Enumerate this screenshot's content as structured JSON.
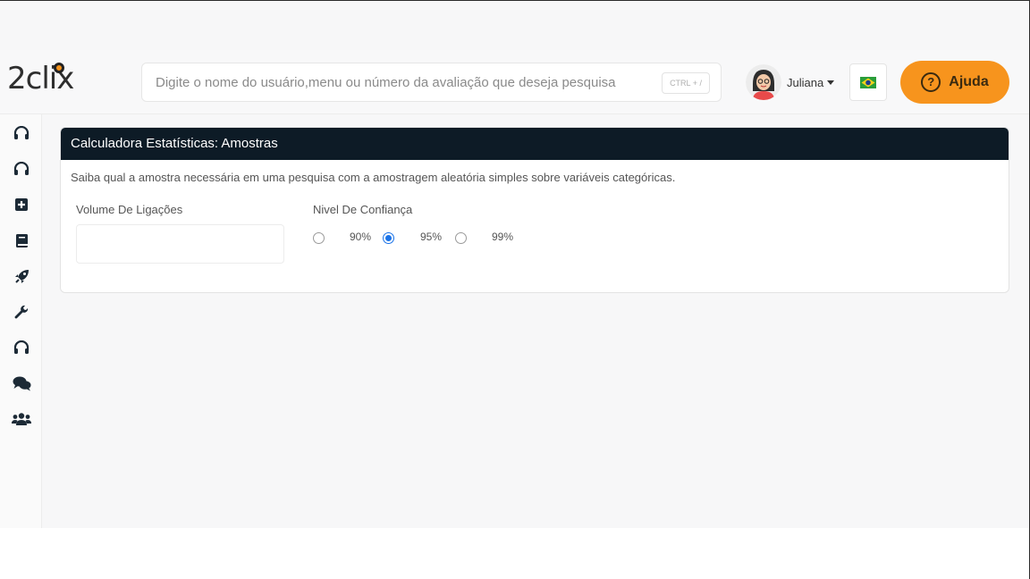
{
  "header": {
    "logo_text": "2clix",
    "search_placeholder": "Digite o nome do usuário,menu ou número da avaliação que deseja pesquisa",
    "search_shortcut": "CTRL + /",
    "user_name": "Juliana",
    "help_label": "Ajuda",
    "help_icon_glyph": "?",
    "accent_color": "#f7941d"
  },
  "sidebar": {
    "icons": [
      "headset-icon",
      "headset-icon",
      "plus-square-icon",
      "book-icon",
      "rocket-icon",
      "wrench-icon",
      "headset-icon",
      "chat-bubbles-icon",
      "users-icon"
    ]
  },
  "card": {
    "title": "Calculadora Estatísticas: Amostras",
    "description": "Saiba qual a amostra necessária em uma pesquisa com a amostragem aleatória simples sobre variáveis categóricas.",
    "volume_label": "Volume De Ligações",
    "volume_value": "",
    "confidence_label": "Nivel De Confiança",
    "confidence_options": [
      "90%",
      "95%",
      "99%"
    ],
    "confidence_selected": "95%",
    "header_color": "#0d1b26"
  }
}
